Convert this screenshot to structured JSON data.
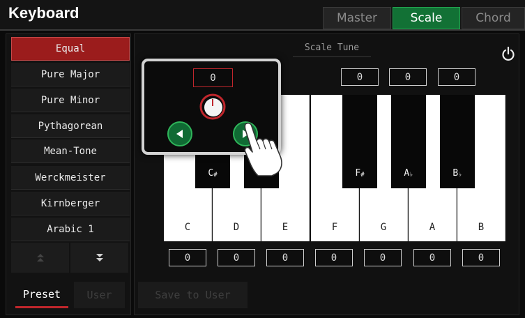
{
  "header": {
    "title": "Keyboard",
    "tabs": [
      {
        "label": "Master",
        "active": false
      },
      {
        "label": "Scale",
        "active": true
      },
      {
        "label": "Chord",
        "active": false
      }
    ]
  },
  "scale_list": {
    "items": [
      "Equal",
      "Pure Major",
      "Pure Minor",
      "Pythagorean",
      "Mean-Tone",
      "Werckmeister",
      "Kirnberger",
      "Arabic 1"
    ],
    "selected": "Equal"
  },
  "bottom_tabs": {
    "preset": "Preset",
    "user": "User",
    "active": "Preset"
  },
  "main": {
    "section_title": "Scale Tune",
    "save_button": "Save to User",
    "top_values": [
      "0",
      "0",
      "0"
    ],
    "black_keys": [
      "C#",
      "E♭",
      "F#",
      "A♭",
      "B♭"
    ],
    "black_key_labels": {
      "cs": "C",
      "cs_sup": "#",
      "eb": "E",
      "fs": "F",
      "fs_sup": "#",
      "ab": "A",
      "ab_sup": "♭",
      "bb": "B",
      "bb_sup": "♭"
    },
    "white_keys": [
      "C",
      "D",
      "E",
      "F",
      "G",
      "A",
      "B"
    ],
    "bottom_values": [
      "0",
      "0",
      "0",
      "0",
      "0",
      "0",
      "0"
    ]
  },
  "popup": {
    "value": "0"
  },
  "colors": {
    "accent_green": "#127135",
    "selected_red": "#9b1c1c",
    "value_box_red": "#c0262c"
  },
  "icons": [
    "power-icon",
    "up-arrow-icon",
    "down-arrow-icon",
    "left-arrow-icon",
    "right-arrow-icon",
    "knob-icon",
    "hand-pointer-icon"
  ]
}
